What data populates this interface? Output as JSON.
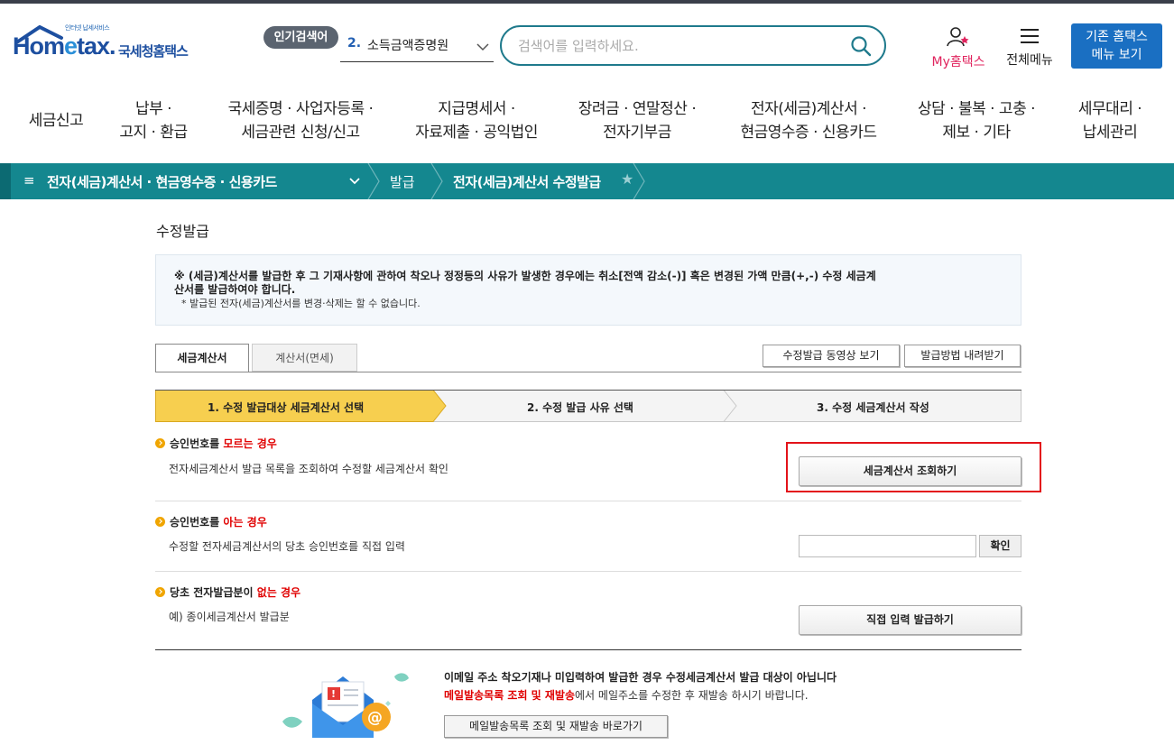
{
  "header": {
    "logo_small": "인터넷 납세서비스",
    "logo_home": "Hom",
    "logo_e": "e",
    "logo_tax": "tax.",
    "logo_kr": "국세청홈택스",
    "popular_badge": "인기검색어",
    "popular_num": "2.",
    "popular_text": "소득금액증명원",
    "search_placeholder": "검색어를 입력하세요.",
    "my_label": "My홈택스",
    "allmenu_label": "전체메뉴",
    "old_line1": "기존 홈택스",
    "old_line2": "메뉴 보기"
  },
  "nav": [
    {
      "l1": "세금신고",
      "l2": ""
    },
    {
      "l1": "납부 ·",
      "l2": "고지 · 환급"
    },
    {
      "l1": "국세증명 · 사업자등록 ·",
      "l2": "세금관련 신청/신고"
    },
    {
      "l1": "지급명세서 ·",
      "l2": "자료제출 · 공익법인"
    },
    {
      "l1": "장려금 · 연말정산 ·",
      "l2": "전자기부금"
    },
    {
      "l1": "전자(세금)계산서 ·",
      "l2": "현금영수증 · 신용카드"
    },
    {
      "l1": "상담 · 불복 · 고충 ·",
      "l2": "제보 · 기타"
    },
    {
      "l1": "세무대리 ·",
      "l2": "납세관리"
    }
  ],
  "breadcrumb": {
    "level1": "전자(세금)계산서 · 현금영수증 · 신용카드",
    "level2": "발급",
    "level3": "전자(세금)계산서 수정발급"
  },
  "page": {
    "title": "수정발급",
    "notice_line1": "※ (세금)계산서를 발급한 후 그 기재사항에 관하여 착오나 정정등의 사유가 발생한 경우에는 취소[전액 감소(-)] 혹은 변경된 가액 만큼(+,-) 수정 세금계",
    "notice_line2": "산서를 발급하여야 합니다.",
    "notice_sub": "* 발급된 전자(세금)계산서를 변경·삭제는 할 수 없습니다."
  },
  "tabs": {
    "tax_invoice": "세금계산서",
    "invoice_exempt": "계산서(면세)"
  },
  "buttons": {
    "video": "수정발급 동영상 보기",
    "download": "발급방법 내려받기"
  },
  "steps": [
    "1. 수정 발급대상 세금계산서 선택",
    "2. 수정 발급 사유 선택",
    "3. 수정 세금계산서 작성"
  ],
  "sections": {
    "unknown": {
      "title_pre": "승인번호를 ",
      "title_red": "모르는 경우",
      "desc": "전자세금계산서 발급 목록을 조회하여 수정할 세금계산서 확인",
      "button": "세금계산서 조회하기"
    },
    "known": {
      "title_pre": "승인번호를 ",
      "title_red": "아는 경우",
      "desc": "수정할 전자세금계산서의 당초 승인번호를 직접 입력",
      "input_value": "",
      "button": "확인"
    },
    "none": {
      "title_pre": "당초 전자발급분이 ",
      "title_red": "없는 경우",
      "desc": "예) 종이세금계산서 발급분",
      "button": "직접 입력 발급하기"
    }
  },
  "email": {
    "title": "이메일 주소 착오기재나 미입력하여 발급한 경우 수정세금계산서 발급 대상이 아닙니다",
    "desc_red": "메일발송목록 조회 및 재발송",
    "desc_rest": "에서 메일주소를 수정한 후 재발송 하시기 바랍니다.",
    "button": "메일발송목록 조회 및 재발송 바로가기"
  },
  "colors": {
    "brand_blue": "#1d4fa0",
    "teal_bar": "#14878f",
    "step_active": "#f7cf4f",
    "highlight_red": "#e3131a",
    "accent_red": "#e00000"
  }
}
